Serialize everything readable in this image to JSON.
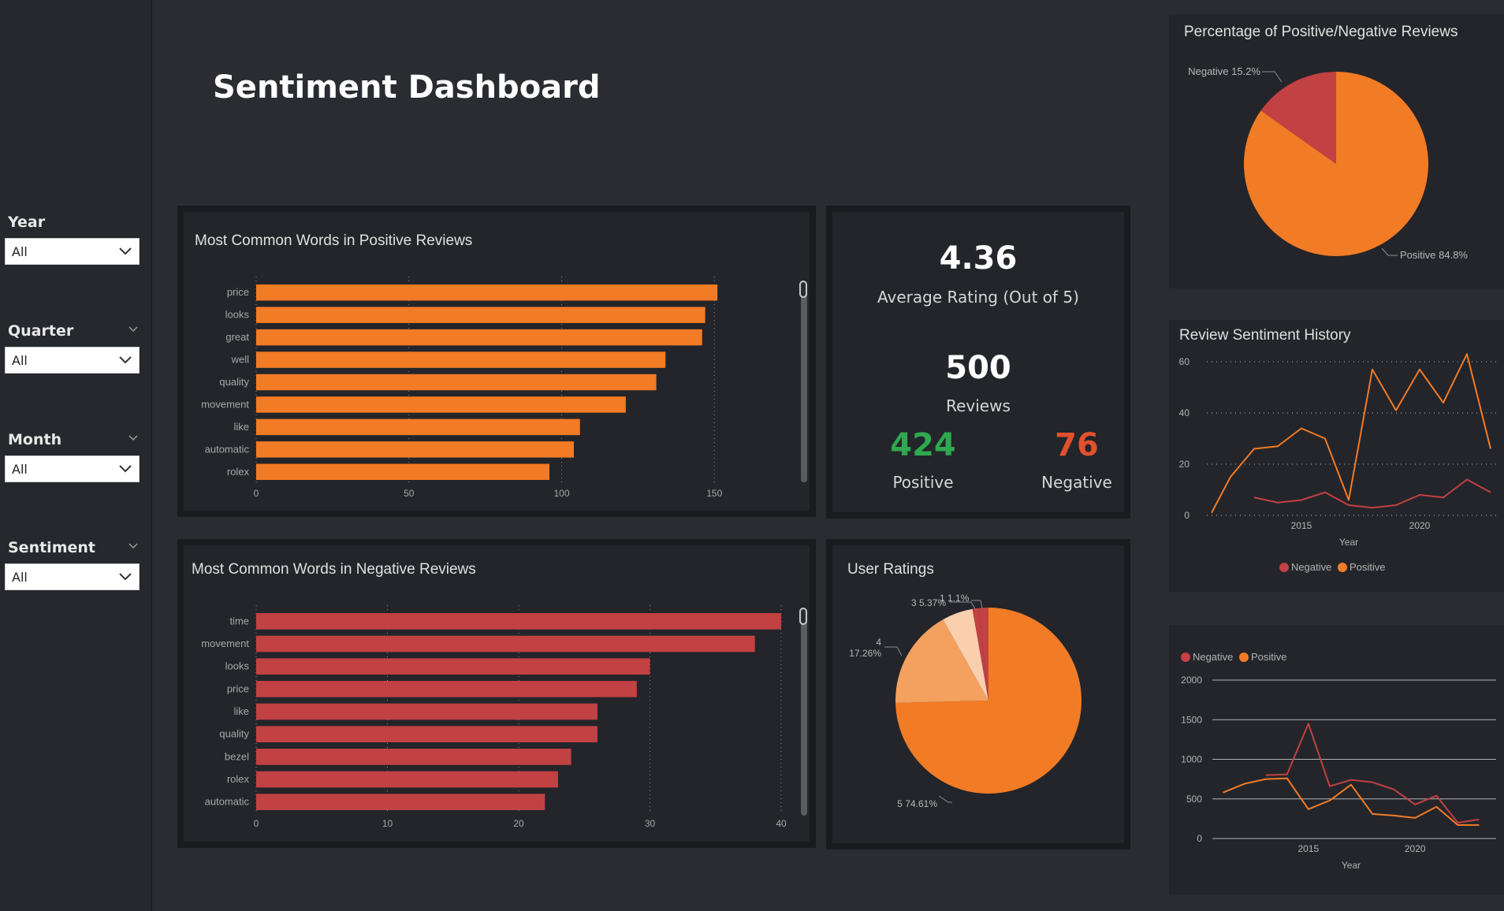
{
  "page_title": "Sentiment Dashboard",
  "filters": [
    {
      "label": "Year",
      "value": "All",
      "has_chevron": false
    },
    {
      "label": "Quarter",
      "value": "All",
      "has_chevron": true
    },
    {
      "label": "Month",
      "value": "All",
      "has_chevron": true
    },
    {
      "label": "Sentiment",
      "value": "All",
      "has_chevron": true
    }
  ],
  "colors": {
    "positive": "#f27b25",
    "negative": "#c24143",
    "kpi_positive": "#2fa84f",
    "kpi_negative": "#e0512c",
    "rating_4": "#f4a05e",
    "rating_3": "#f9cfae",
    "rating_1": "#c24143"
  },
  "kpis": {
    "avg_rating": "4.36",
    "avg_rating_label": "Average Rating (Out of 5)",
    "reviews": "500",
    "reviews_label": "Reviews",
    "positive": "424",
    "positive_label": "Positive",
    "negative": "76",
    "negative_label": "Negative"
  },
  "chart_data": [
    {
      "id": "positive_words",
      "type": "bar",
      "orientation": "horizontal",
      "title": "Most Common Words in Positive Reviews",
      "categories": [
        "price",
        "looks",
        "great",
        "well",
        "quality",
        "movement",
        "like",
        "automatic",
        "rolex"
      ],
      "values": [
        151,
        147,
        146,
        134,
        131,
        121,
        106,
        104,
        96
      ],
      "xlim": [
        0,
        160
      ],
      "xticks": [
        "0",
        "50",
        "100",
        "150"
      ],
      "grid": "dotted"
    },
    {
      "id": "negative_words",
      "type": "bar",
      "orientation": "horizontal",
      "title": "Most Common Words in Negative Reviews",
      "categories": [
        "time",
        "movement",
        "looks",
        "price",
        "like",
        "quality",
        "bezel",
        "rolex",
        "automatic"
      ],
      "values": [
        40,
        38,
        30,
        29,
        26,
        26,
        24,
        23,
        22
      ],
      "xlim": [
        0,
        40
      ],
      "xticks": [
        "0",
        "10",
        "20",
        "30",
        "40"
      ],
      "grid": "dotted"
    },
    {
      "id": "sentiment_pct",
      "type": "pie",
      "title": "Percentage of Positive/Negative Reviews",
      "slices": [
        {
          "label": "Negative 15.2%",
          "value": 15.2
        },
        {
          "label": "Positive 84.8%",
          "value": 84.8
        }
      ]
    },
    {
      "id": "user_ratings",
      "type": "pie",
      "title": "User Ratings",
      "slices": [
        {
          "label": "5 74.61%",
          "value": 74.61
        },
        {
          "label": "4 17.26%",
          "label_line1": "4",
          "label_line2": "17.26%",
          "value": 17.26
        },
        {
          "label": "3 5.37%",
          "value": 5.37
        },
        {
          "label": "1 1.1%",
          "value": 1.1
        },
        {
          "label": "",
          "value": 1.66
        }
      ]
    },
    {
      "id": "sentiment_history",
      "type": "line",
      "title": "Review Sentiment History",
      "xlabel": "Year",
      "ylim": [
        0,
        60
      ],
      "yticks": [
        "0",
        "20",
        "40",
        "60"
      ],
      "xticks": [
        "2015",
        "2020"
      ],
      "xtick_values": [
        2015,
        2020
      ],
      "xlim": [
        2011,
        2023
      ],
      "legend": [
        "Negative",
        "Positive"
      ],
      "series": [
        {
          "name": "Negative",
          "x": [
            2013,
            2014,
            2015,
            2016,
            2017,
            2018,
            2019,
            2020,
            2021,
            2022,
            2023
          ],
          "values": [
            7,
            5,
            6,
            9,
            4,
            3,
            4,
            8,
            7,
            14,
            9
          ]
        },
        {
          "name": "Positive",
          "x": [
            2011.2,
            2012,
            2013,
            2014,
            2015,
            2016,
            2017,
            2018,
            2019,
            2020,
            2021,
            2022,
            2023
          ],
          "values": [
            1,
            15,
            26,
            27,
            34,
            30,
            6,
            57,
            41,
            57,
            44,
            63,
            26
          ]
        }
      ]
    },
    {
      "id": "history_2",
      "type": "line",
      "title": "",
      "xlabel": "Year",
      "ylim": [
        0,
        2000
      ],
      "yticks": [
        "0",
        "500",
        "1000",
        "1500",
        "2000"
      ],
      "xticks": [
        "2015",
        "2020"
      ],
      "xtick_values": [
        2015,
        2020
      ],
      "xlim": [
        2010.5,
        2023.5
      ],
      "legend": [
        "Negative",
        "Positive"
      ],
      "series": [
        {
          "name": "Negative",
          "x": [
            2013,
            2014,
            2015,
            2016,
            2017,
            2018,
            2019,
            2020,
            2021,
            2022,
            2023
          ],
          "values": [
            800,
            810,
            1450,
            660,
            740,
            710,
            620,
            430,
            540,
            200,
            240
          ]
        },
        {
          "name": "Positive",
          "x": [
            2011,
            2012,
            2013,
            2014,
            2015,
            2016,
            2017,
            2018,
            2019,
            2020,
            2021,
            2022,
            2023
          ],
          "values": [
            580,
            690,
            750,
            760,
            370,
            480,
            680,
            310,
            290,
            260,
            400,
            170,
            170
          ]
        }
      ]
    }
  ]
}
